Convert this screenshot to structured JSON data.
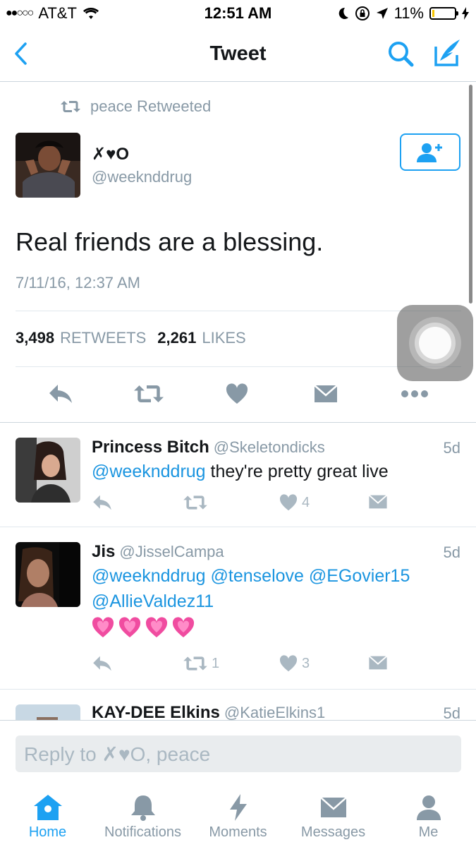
{
  "status_bar": {
    "carrier": "AT&T",
    "time": "12:51 AM",
    "battery_percent": "11%",
    "signal_dots": "●●○○○",
    "battery_level": 0.11
  },
  "nav": {
    "title": "Tweet"
  },
  "tweet": {
    "retweeted_by": "peace Retweeted",
    "author_name": "✗♥O",
    "author_handle": "@weeknddrug",
    "text": "Real friends are a blessing.",
    "timestamp": "7/11/16, 12:37 AM",
    "retweets_count": "3,498",
    "retweets_label": "RETWEETS",
    "likes_count": "2,261",
    "likes_label": "LIKES"
  },
  "replies": [
    {
      "name": "Princess Bitch",
      "handle": "@Skeletondicks",
      "age": "5d",
      "mention": "@weeknddrug",
      "text": " they're pretty great live",
      "retweets": "",
      "likes": "4"
    },
    {
      "name": "Jis",
      "handle": "@JisselCampa",
      "age": "5d",
      "mentions_line1": "@weeknddrug @tenselove @EGovier15",
      "mentions_line2": "@AllieValdez11",
      "emoji": "💗💗💗💗",
      "retweets": "1",
      "likes": "3"
    },
    {
      "name": "KAY-DEE Elkins",
      "handle": "@KatieElkins1",
      "age": "5d"
    }
  ],
  "composer": {
    "placeholder": "Reply to ✗♥O, peace"
  },
  "tabs": [
    {
      "label": "Home",
      "icon": "home-icon",
      "active": true
    },
    {
      "label": "Notifications",
      "icon": "bell-icon",
      "active": false
    },
    {
      "label": "Moments",
      "icon": "lightning-icon",
      "active": false
    },
    {
      "label": "Messages",
      "icon": "envelope-icon",
      "active": false
    },
    {
      "label": "Me",
      "icon": "person-icon",
      "active": false
    }
  ],
  "colors": {
    "accent": "#1da1f2",
    "link": "#1b95e0",
    "muted": "#8899a6",
    "icon_gray": "#aab8c2"
  }
}
